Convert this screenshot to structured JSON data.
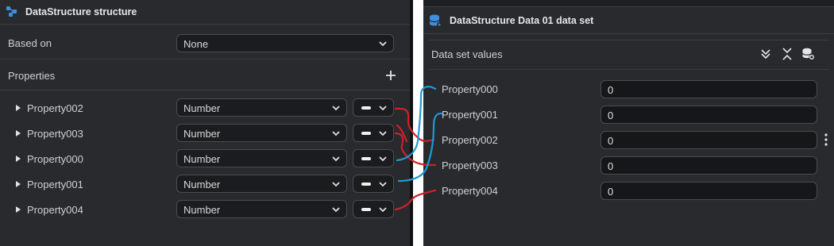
{
  "left_panel": {
    "title": "DataStructure structure",
    "based_on": {
      "label": "Based on",
      "value": "None"
    },
    "properties_label": "Properties",
    "add_icon": "plus-icon",
    "rows": [
      {
        "name": "Property002",
        "type": "Number"
      },
      {
        "name": "Property003",
        "type": "Number"
      },
      {
        "name": "Property000",
        "type": "Number"
      },
      {
        "name": "Property001",
        "type": "Number"
      },
      {
        "name": "Property004",
        "type": "Number"
      }
    ]
  },
  "right_panel": {
    "title": "DataStructure Data 01 data set",
    "values_label": "Data set values",
    "toolbar_icons": [
      "expand-all-icon",
      "collapse-all-icon",
      "database-settings-icon"
    ],
    "rows": [
      {
        "name": "Property000",
        "value": "0"
      },
      {
        "name": "Property001",
        "value": "0"
      },
      {
        "name": "Property002",
        "value": "0"
      },
      {
        "name": "Property003",
        "value": "0"
      },
      {
        "name": "Property004",
        "value": "0"
      }
    ]
  },
  "colors": {
    "panel_bg": "#282a2d",
    "annotation_red": "#d0202a",
    "annotation_blue": "#1a9ad6",
    "accent_icon": "#3d8fe0"
  }
}
